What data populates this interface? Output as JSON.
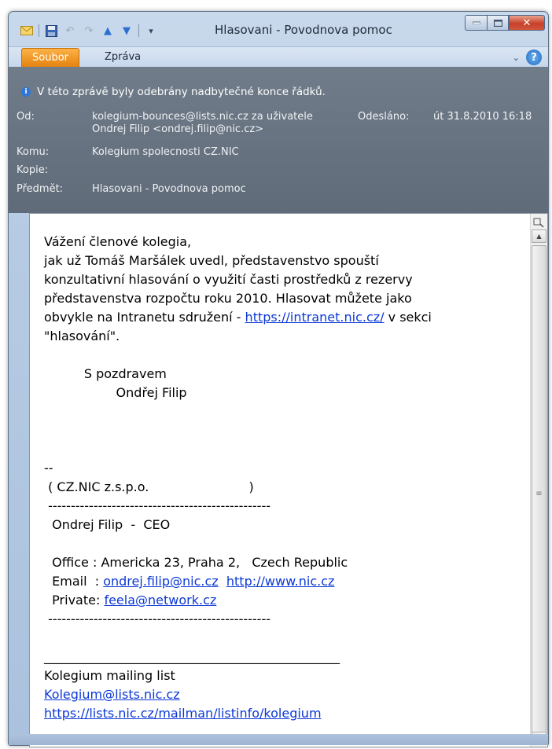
{
  "window": {
    "title": "Hlasovani - Povodnova pomoc"
  },
  "quick_access": {
    "icons": [
      "mail-icon",
      "save-icon",
      "undo-icon",
      "redo-icon",
      "up-arrow-icon",
      "down-arrow-icon",
      "customize-icon"
    ]
  },
  "ribbon": {
    "file_tab": "Soubor",
    "message_tab": "Zpráva"
  },
  "header": {
    "info": "V této zprávě byly odebrány nadbytečné konce řádků.",
    "from_label": "Od:",
    "from_line1": "kolegium-bounces@lists.nic.cz za uživatele",
    "from_line2": "Ondrej Filip <ondrej.filip@nic.cz>",
    "sent_label": "Odesláno:",
    "sent_value": "út 31.8.2010 16:18",
    "to_label": "Komu:",
    "to_value": "Kolegium spolecnosti CZ.NIC",
    "cc_label": "Kopie:",
    "cc_value": "",
    "subject_label": "Předmět:",
    "subject_value": "Hlasovani - Povodnova pomoc"
  },
  "body": {
    "greeting": "Vážení členové kolegia,",
    "p1": "jak už Tomáš Maršálek uvedl, představenstvo spouští",
    "p2": "konzultativní hlasování o využití časti prostředků z rezervy",
    "p3": "představenstva rozpočtu roku 2010. Hlasovat můžete jako",
    "p4_pre": "obvykle na Intranetu sdružení - ",
    "p4_link": "https://intranet.nic.cz/",
    "p4_post": " v sekci",
    "p5": "\"hlasování\".",
    "regards": "          S pozdravem",
    "signer": "                  Ondřej Filip",
    "sig_dash": "--",
    "org": " ( CZ.NIC z.s.p.o.                         )",
    "rule1": " -------------------------------------------------",
    "name": "  Ondrej Filip  -  CEO",
    "office": "  Office : Americka 23, Praha 2,   Czech Republic",
    "email_label": "  Email  : ",
    "email_link": "ondrej.filip@nic.cz",
    "email_sep": "  ",
    "web_link": "http://www.nic.cz",
    "private_label": "  Private: ",
    "private_link": "feela@network.cz",
    "rule2": " -------------------------------------------------",
    "underline": "_______________________________________________",
    "list_name": "Kolegium mailing list",
    "list_email": "Kolegium@lists.nic.cz",
    "list_url": "https://lists.nic.cz/mailman/listinfo/kolegium"
  },
  "colors": {
    "accent_file_tab": "#e5830f",
    "link": "#0b38d6",
    "header_bg": "#6b7784"
  }
}
